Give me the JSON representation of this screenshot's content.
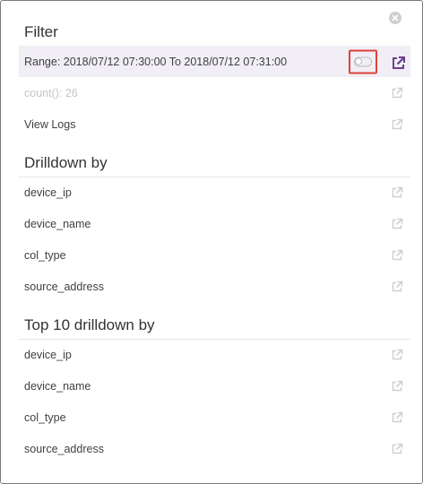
{
  "header": {
    "title": "Filter"
  },
  "filter": {
    "range_label": "Range: 2018/07/12 07:30:00 To 2018/07/12 07:31:00",
    "count_label": "count(): 26",
    "view_logs_label": "View Logs"
  },
  "drilldown": {
    "title": "Drilldown by",
    "items": [
      {
        "label": "device_ip"
      },
      {
        "label": "device_name"
      },
      {
        "label": "col_type"
      },
      {
        "label": "source_address"
      }
    ]
  },
  "top_drilldown": {
    "title": "Top 10 drilldown by",
    "items": [
      {
        "label": "device_ip"
      },
      {
        "label": "device_name"
      },
      {
        "label": "col_type"
      },
      {
        "label": "source_address"
      }
    ]
  },
  "colors": {
    "accent": "#6b3f8c",
    "highlight_border": "#e0413a",
    "filter_row_bg": "#f1eff5",
    "disabled_icon": "#d0d0d0"
  },
  "icons": {
    "close": "close-icon",
    "external": "external-link-icon",
    "toggle": "toggle-icon"
  }
}
